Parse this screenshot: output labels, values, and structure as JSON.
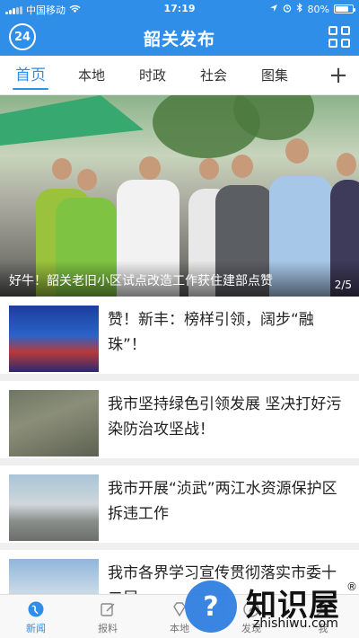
{
  "status_bar": {
    "carrier": "中国移动",
    "time": "17:19",
    "battery_text": "80%",
    "battery_level_percent": 80
  },
  "nav": {
    "title": "韶关发布",
    "badge": "24"
  },
  "tabs": [
    {
      "label": "首页",
      "active": true
    },
    {
      "label": "本地",
      "active": false
    },
    {
      "label": "时政",
      "active": false
    },
    {
      "label": "社会",
      "active": false
    },
    {
      "label": "图集",
      "active": false
    }
  ],
  "tab_add": "+",
  "hero": {
    "caption": "好牛！韶关老旧小区试点改造工作获住建部点赞",
    "page": "2/5"
  },
  "articles": [
    {
      "title": "赞！新丰：榜样引领，阔步“融珠”！"
    },
    {
      "title": "我市坚持绿色引领发展 坚决打好污染防治攻坚战！"
    },
    {
      "title": "我市开展“浈武”两江水资源保护区拆违工作"
    },
    {
      "title": "我市各界学习宣传贯彻落实市委十二届..."
    }
  ],
  "bottom_nav": [
    {
      "label": "新闻",
      "icon": "globe-icon",
      "active": true
    },
    {
      "label": "报料",
      "icon": "edit-icon",
      "active": false
    },
    {
      "label": "本地",
      "icon": "diamond-icon",
      "active": false
    },
    {
      "label": "发现",
      "icon": "compass-icon",
      "active": false
    },
    {
      "label": "我",
      "icon": "person-icon",
      "active": false
    }
  ],
  "watermark": {
    "brand": "知识屋",
    "url": "zhishiwu.com",
    "mark": "®",
    "glyph": "?"
  },
  "colors": {
    "brand_blue": "#2f8ee8",
    "text_dark": "#222222",
    "separator": "#efefef"
  }
}
